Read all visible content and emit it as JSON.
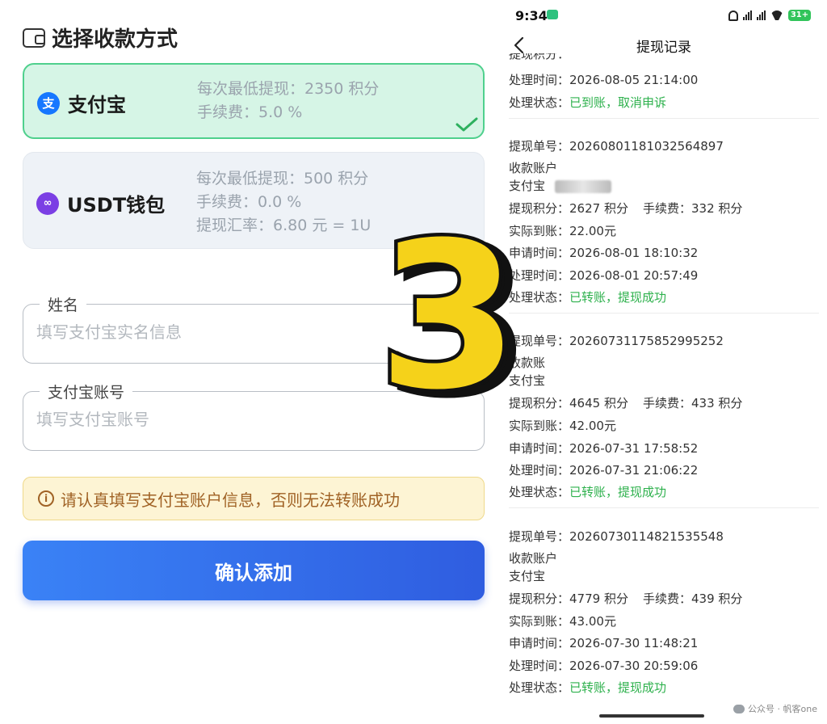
{
  "left": {
    "section_title": "选择收款方式",
    "methods": [
      {
        "name": "支付宝",
        "logo_char": "支",
        "lines": [
          "每次最低提现：2350 积分",
          "手续费：5.0 %"
        ],
        "selected": true
      },
      {
        "name": "USDT钱包",
        "logo_char": "∞",
        "lines": [
          "每次最低提现：500 积分",
          "手续费：0.0 %",
          "提现汇率：6.80 元 = 1U"
        ],
        "selected": false
      }
    ],
    "fields": {
      "name_label": "姓名",
      "name_placeholder": "填写支付宝实名信息",
      "account_label": "支付宝账号",
      "account_placeholder": "填写支付宝账号"
    },
    "notice": "请认真填写支付宝账户信息，否则无法转账成功",
    "confirm_label": "确认添加"
  },
  "big_number": "3",
  "phone": {
    "time": "9:34",
    "battery": "31+",
    "title": "提现记录",
    "top_partial": {
      "processed_label": "处理时间：",
      "processed": "2026-08-05 21:14:00",
      "status_label": "处理状态：",
      "status": "已到账，取消申诉"
    },
    "records": [
      {
        "order_label": "提现单号：",
        "order_no": "20260801181032564897",
        "account_label": "收款账户",
        "account_type": "支付宝",
        "points_label": "提现积分：",
        "points": "2627 积分",
        "fee_label": "手续费：",
        "fee": "332 积分",
        "received_label": "实际到账：",
        "received": "22.00元",
        "apply_label": "申请时间：",
        "apply_time": "2026-08-01 18:10:32",
        "processed_label": "处理时间：",
        "processed_time": "2026-08-01 20:57:49",
        "status_label": "处理状态：",
        "status": "已转账，提现成功"
      },
      {
        "order_label": "提现单号：",
        "order_no": "20260731175852995252",
        "account_label": "收款账",
        "account_type": "支付宝",
        "points_label": "提现积分：",
        "points": "4645 积分",
        "fee_label": "手续费：",
        "fee": "433 积分",
        "received_label": "实际到账：",
        "received": "42.00元",
        "apply_label": "申请时间：",
        "apply_time": "2026-07-31 17:58:52",
        "processed_label": "处理时间：",
        "processed_time": "2026-07-31 21:06:22",
        "status_label": "处理状态：",
        "status": "已转账，提现成功"
      },
      {
        "order_label": "提现单号：",
        "order_no": "20260730114821535548",
        "account_label": "收款账户",
        "account_type": "支付宝",
        "points_label": "提现积分：",
        "points": "4779 积分",
        "fee_label": "手续费：",
        "fee": "439 积分",
        "received_label": "实际到账：",
        "received": "43.00元",
        "apply_label": "申请时间：",
        "apply_time": "2026-07-30 11:48:21",
        "processed_label": "处理时间：",
        "processed_time": "2026-07-30 20:59:06",
        "status_label": "处理状态：",
        "status": "已转账，提现成功"
      }
    ],
    "watermark": "公众号 · 帆客one"
  },
  "colors": {
    "alipay_card_bg": "#d6f5e6",
    "alipay_card_border": "#4fd08d",
    "confirm_btn": "#2f5de0",
    "notice_text": "#a06225",
    "status_green": "#2eb14d",
    "big_number_fill": "#f5d21a"
  }
}
